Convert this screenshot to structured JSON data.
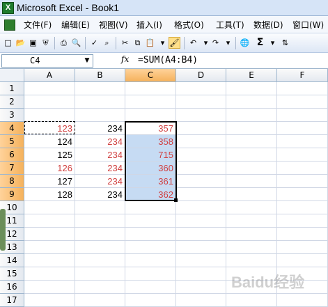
{
  "window": {
    "title": "Microsoft Excel - Book1",
    "logo": "X"
  },
  "menu": {
    "items": [
      "文件(F)",
      "编辑(E)",
      "视图(V)",
      "插入(I)",
      "格式(O)",
      "工具(T)",
      "数据(D)",
      "窗口(W)"
    ]
  },
  "toolbar": {
    "icons": [
      "new-icon",
      "open-icon",
      "save-icon",
      "permission-icon",
      "print-icon",
      "print-preview-icon",
      "spelling-icon",
      "research-icon",
      "cut-icon",
      "copy-icon",
      "paste-icon",
      "format-painter-icon",
      "undo-icon",
      "redo-icon",
      "hyperlink-icon",
      "autosum-icon",
      "sort-icon"
    ],
    "sigma": "Σ"
  },
  "formula_bar": {
    "name_box": "C4",
    "fx": "fx",
    "formula": "=SUM(A4:B4)"
  },
  "grid": {
    "columns": [
      "A",
      "B",
      "C",
      "D",
      "E",
      "F"
    ],
    "rows": [
      "1",
      "2",
      "3",
      "4",
      "5",
      "6",
      "7",
      "8",
      "9",
      "10",
      "11",
      "12",
      "13",
      "14",
      "15",
      "16",
      "17"
    ],
    "selected_column": "C",
    "selected_rows": [
      "4",
      "5",
      "6",
      "7",
      "8",
      "9"
    ],
    "cells": {
      "A4": "123",
      "B4": "234",
      "C4": "357",
      "A5": "124",
      "B5": "234",
      "C5": "358",
      "A6": "125",
      "B6": "234",
      "C6": "715",
      "A7": "126",
      "B7": "234",
      "C7": "360",
      "A8": "127",
      "B8": "234",
      "C8": "361",
      "A9": "128",
      "B9": "234",
      "C9": "362"
    }
  },
  "colors": {
    "accent": "#f5b25c",
    "red_text": "#d04040",
    "selection": "#c6dbf3"
  },
  "watermark": "Baidu经验"
}
